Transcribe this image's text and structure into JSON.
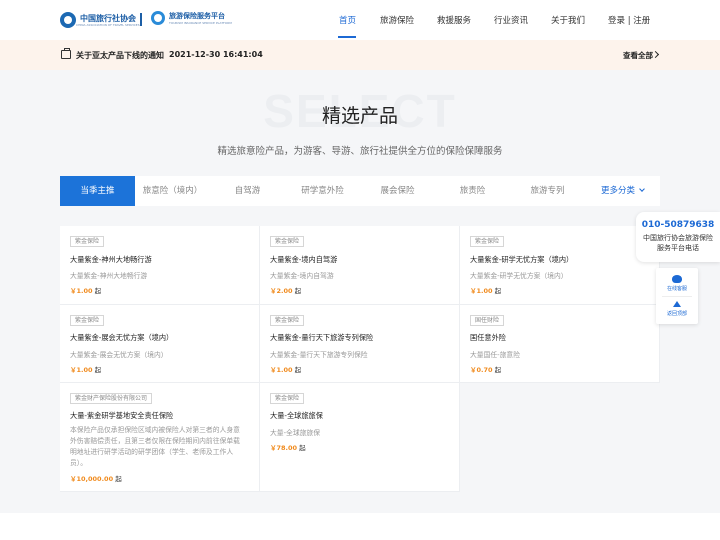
{
  "header": {
    "logo_left_cn": "中国旅行社协会",
    "logo_left_en": "CHINA ASSOCIATION OF TRAVEL SERVICES",
    "logo_right_cn": "旅游保险服务平台",
    "logo_right_en": "TOURISM INSURANCE SERVICE PLATFORM",
    "nav": [
      {
        "label": "首页",
        "active": true
      },
      {
        "label": "旅游保险",
        "active": false
      },
      {
        "label": "救援服务",
        "active": false
      },
      {
        "label": "行业资讯",
        "active": false
      },
      {
        "label": "关于我们",
        "active": false
      },
      {
        "label": "登录 | 注册",
        "active": false
      }
    ]
  },
  "notice": {
    "title": "关于亚太产品下线的通知",
    "time": "2021-12-30 16:41:04",
    "more": "查看全部"
  },
  "section": {
    "bg_word": "SELECT",
    "title": "精选产品",
    "subtitle": "精选旅意险产品，为游客、导游、旅行社提供全方位的保险保障服务"
  },
  "tabs": [
    {
      "label": "当季主推",
      "active": true
    },
    {
      "label": "旅意险（境内）",
      "active": false
    },
    {
      "label": "自驾游",
      "active": false
    },
    {
      "label": "研学意外险",
      "active": false
    },
    {
      "label": "展会保险",
      "active": false
    },
    {
      "label": "旅责险",
      "active": false
    },
    {
      "label": "旅游专列",
      "active": false
    },
    {
      "label": "更多分类",
      "active": false
    }
  ],
  "products": [
    {
      "tag": "紫金保险",
      "name": "大量紫金-神州大地畅行游",
      "desc": "大量紫金-神州大地畅行游",
      "price": "￥1.00",
      "unit": "起"
    },
    {
      "tag": "紫金保险",
      "name": "大量紫金-境内自驾游",
      "desc": "大量紫金-境内自驾游",
      "price": "￥2.00",
      "unit": "起"
    },
    {
      "tag": "紫金保险",
      "name": "大量紫金-研学无忧方案（境内）",
      "desc": "大量紫金-研学无忧方案（境内）",
      "price": "￥1.00",
      "unit": "起"
    },
    {
      "tag": "紫金保险",
      "name": "大量紫金-展会无忧方案（境内）",
      "desc": "大量紫金-展会无忧方案（境内）",
      "price": "￥1.00",
      "unit": "起"
    },
    {
      "tag": "紫金保险",
      "name": "大量紫金-量行天下旅游专列保险",
      "desc": "大量紫金-量行天下旅游专列保险",
      "price": "￥1.00",
      "unit": "起"
    },
    {
      "tag": "国任财险",
      "name": "国任意外险",
      "desc": "大量国任-旅意险",
      "price": "￥0.70",
      "unit": "起"
    },
    {
      "tag": "紫金财产保险股份有限公司",
      "name": "大量-紫金研学基地安全责任保险",
      "desc": "本保险产品仅承担保险区域内被保险人对第三者的人身意外伤害赔偿责任，且第三者仅限在保险期间内前往保单载明地址进行研学活动的研学团体（学生、老师及工作人员）。",
      "price": "￥10,000.00",
      "unit": "起"
    },
    {
      "tag": "紫金保险",
      "name": "大量-全球旅旅保",
      "desc": "大量-全球旅旅保",
      "price": "￥78.00",
      "unit": "起"
    }
  ],
  "float": {
    "phone": "010-50879638",
    "text": "中国旅行协会旅游保险服务平台电话",
    "cs_label": "在线客服",
    "top_label": "返回顶部"
  },
  "colors": {
    "accent": "#1c73d9",
    "price": "#f08a1c",
    "notice_bg": "#fdf3ec",
    "section_bg": "#f5f6f8"
  }
}
